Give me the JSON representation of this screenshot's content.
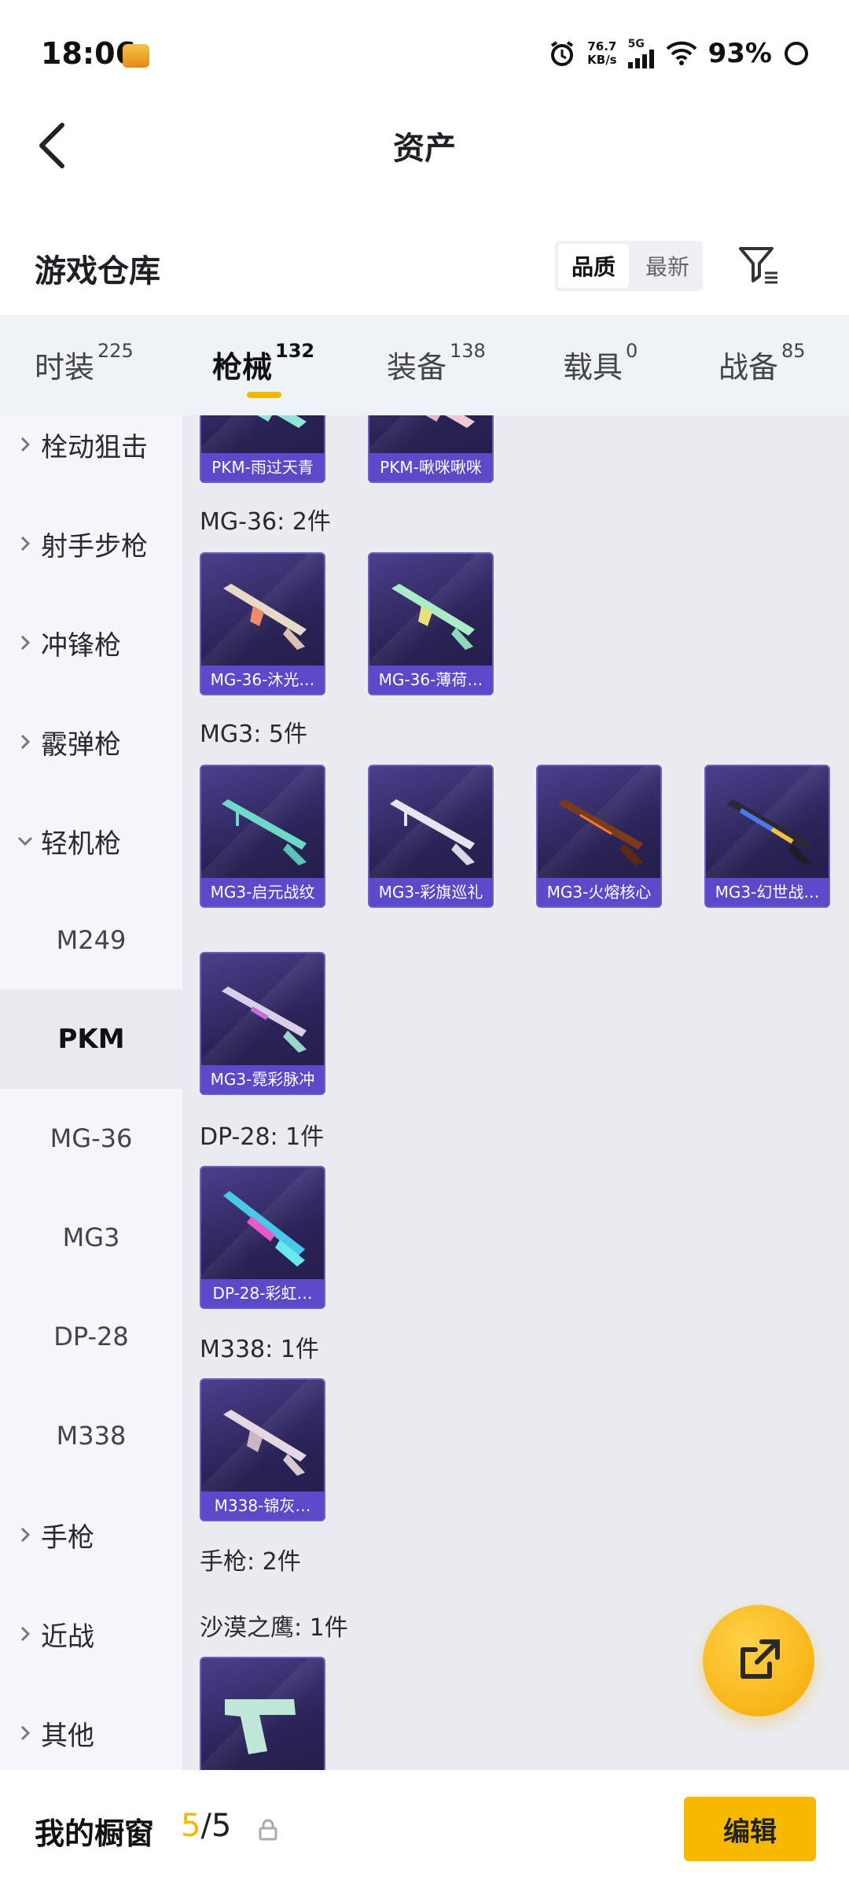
{
  "status_bar": {
    "time": "18:06",
    "net_speed_value": "76.7",
    "net_speed_unit": "KB/s",
    "network": "5G",
    "battery": "93%"
  },
  "nav": {
    "title": "资产"
  },
  "repo": {
    "title": "游戏仓库",
    "sort_options": [
      "品质",
      "最新"
    ]
  },
  "tabs": [
    {
      "label": "时装",
      "count": "225"
    },
    {
      "label": "枪械",
      "count": "132"
    },
    {
      "label": "装备",
      "count": "138"
    },
    {
      "label": "载具",
      "count": "0"
    },
    {
      "label": "战备",
      "count": "85"
    }
  ],
  "sidebar": {
    "categories_top": [
      "栓动狙击",
      "射手步枪",
      "冲锋枪",
      "霰弹枪",
      "轻机枪"
    ],
    "lmg_sub": [
      "M249",
      "PKM",
      "MG-36",
      "MG3",
      "DP-28",
      "M338"
    ],
    "categories_bottom": [
      "手枪",
      "近战",
      "其他"
    ]
  },
  "content": {
    "pkm_items": [
      "PKM-雨过天青",
      "PKM-啾咪啾咪"
    ],
    "mg36_label": "MG-36: 2件",
    "mg36_items": [
      "MG-36-沐光…",
      "MG-36-薄荷…"
    ],
    "mg3_label": "MG3: 5件",
    "mg3_items": [
      "MG3-启元战纹",
      "MG3-彩旗巡礼",
      "MG3-火熔核心",
      "MG3-幻世战…",
      "MG3-霓彩脉冲"
    ],
    "dp28_label": "DP-28: 1件",
    "dp28_items": [
      "DP-28-彩虹…"
    ],
    "m338_label": "M338: 1件",
    "m338_items": [
      "M338-锦灰…"
    ],
    "pistol_label": "手枪: 2件",
    "deagle_label": "沙漠之鹰: 1件"
  },
  "bottom": {
    "showcase_label": "我的橱窗",
    "showcase_current": "5",
    "showcase_total": "/5",
    "edit_label": "编辑"
  },
  "colors": {
    "accent": "#f5b800",
    "card_caption": "#5a49c8",
    "card_bg": "#2a2356"
  }
}
